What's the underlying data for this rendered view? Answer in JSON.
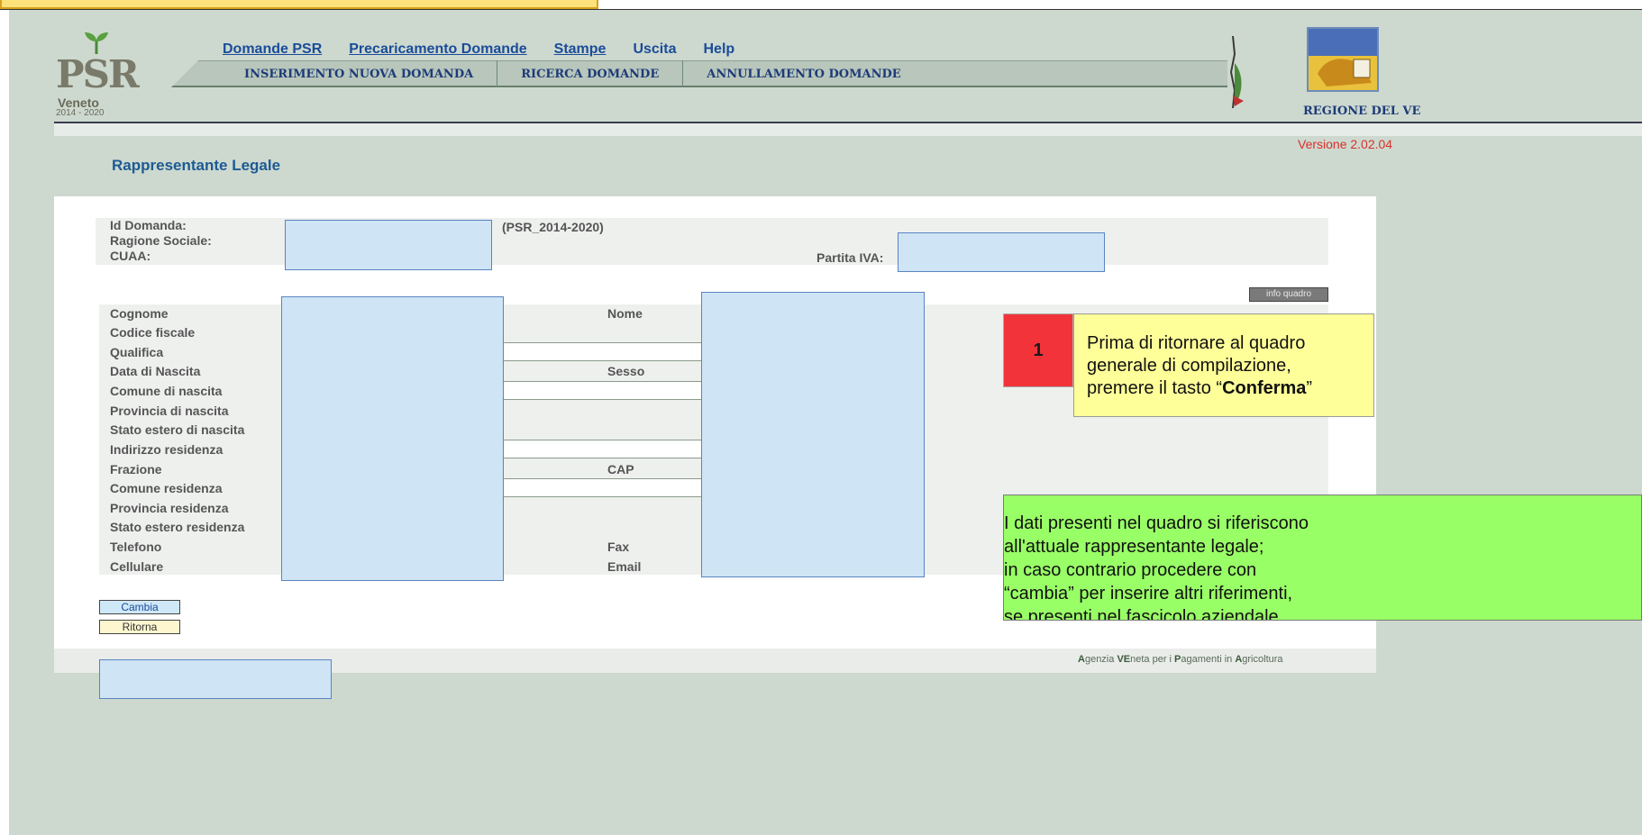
{
  "header": {
    "logo": {
      "main": "PSR",
      "region": "Veneto",
      "years": "2014 - 2020"
    },
    "menu_primary": [
      "Domande PSR",
      "Precaricamento Domande",
      "Stampe",
      "Uscita",
      "Help"
    ],
    "menu_secondary": [
      "INSERIMENTO NUOVA DOMANDA",
      "RICERCA DOMANDE",
      "ANNULLAMENTO DOMANDE"
    ],
    "regione": "REGIONE DEL VE",
    "versione": "Versione 2.02.04"
  },
  "page_title": "Rappresentante Legale",
  "id_block": {
    "id_domanda_label": "Id Domanda:",
    "program": "(PSR_2014-2020)",
    "ragione_sociale_label": "Ragione Sociale:",
    "cuaa_label": "CUAA:",
    "partita_iva_label": "Partita IVA:"
  },
  "info_button": "info quadro",
  "form": {
    "left_labels": [
      "Cognome",
      "Codice fiscale",
      "Qualifica",
      "Data di Nascita",
      "Comune di nascita",
      "Provincia di nascita",
      "Stato estero di nascita",
      "Indirizzo residenza",
      "Frazione",
      "Comune residenza",
      "Provincia residenza",
      "Stato estero residenza",
      "Telefono",
      "Cellulare"
    ],
    "right_labels": {
      "nome": "Nome",
      "sesso": "Sesso",
      "cap": "CAP",
      "fax": "Fax",
      "email": "Email"
    }
  },
  "buttons": {
    "cambia": "Cambia",
    "ritorna": "Ritorna"
  },
  "callout1": {
    "number": "1",
    "line1": "Prima di ritornare al quadro",
    "line2": "generale di compilazione,",
    "line3_pre": "premere il tasto “",
    "line3_bold": "Conferma",
    "line3_post": "”"
  },
  "callout2": {
    "lines": [
      "I dati presenti nel quadro si riferiscono",
      "all'attuale rappresentante legale;",
      "in caso contrario procedere con",
      "“cambia” per inserire altri riferimenti,",
      "se presenti nel fascicolo aziendale"
    ]
  },
  "footer": {
    "text_a": "A",
    "text_b": "genzia ",
    "text_c": "VE",
    "text_d": "neta per i ",
    "text_e": "P",
    "text_f": "agamenti in ",
    "text_g": "A",
    "text_h": "gricoltura"
  },
  "colors": {
    "menu_link": "#1a4c99",
    "title": "#1e5a93",
    "versione": "#d9302a",
    "callout_yellow": "#ffff99",
    "callout_green": "#99ff66",
    "callout_red": "#f2343a"
  }
}
